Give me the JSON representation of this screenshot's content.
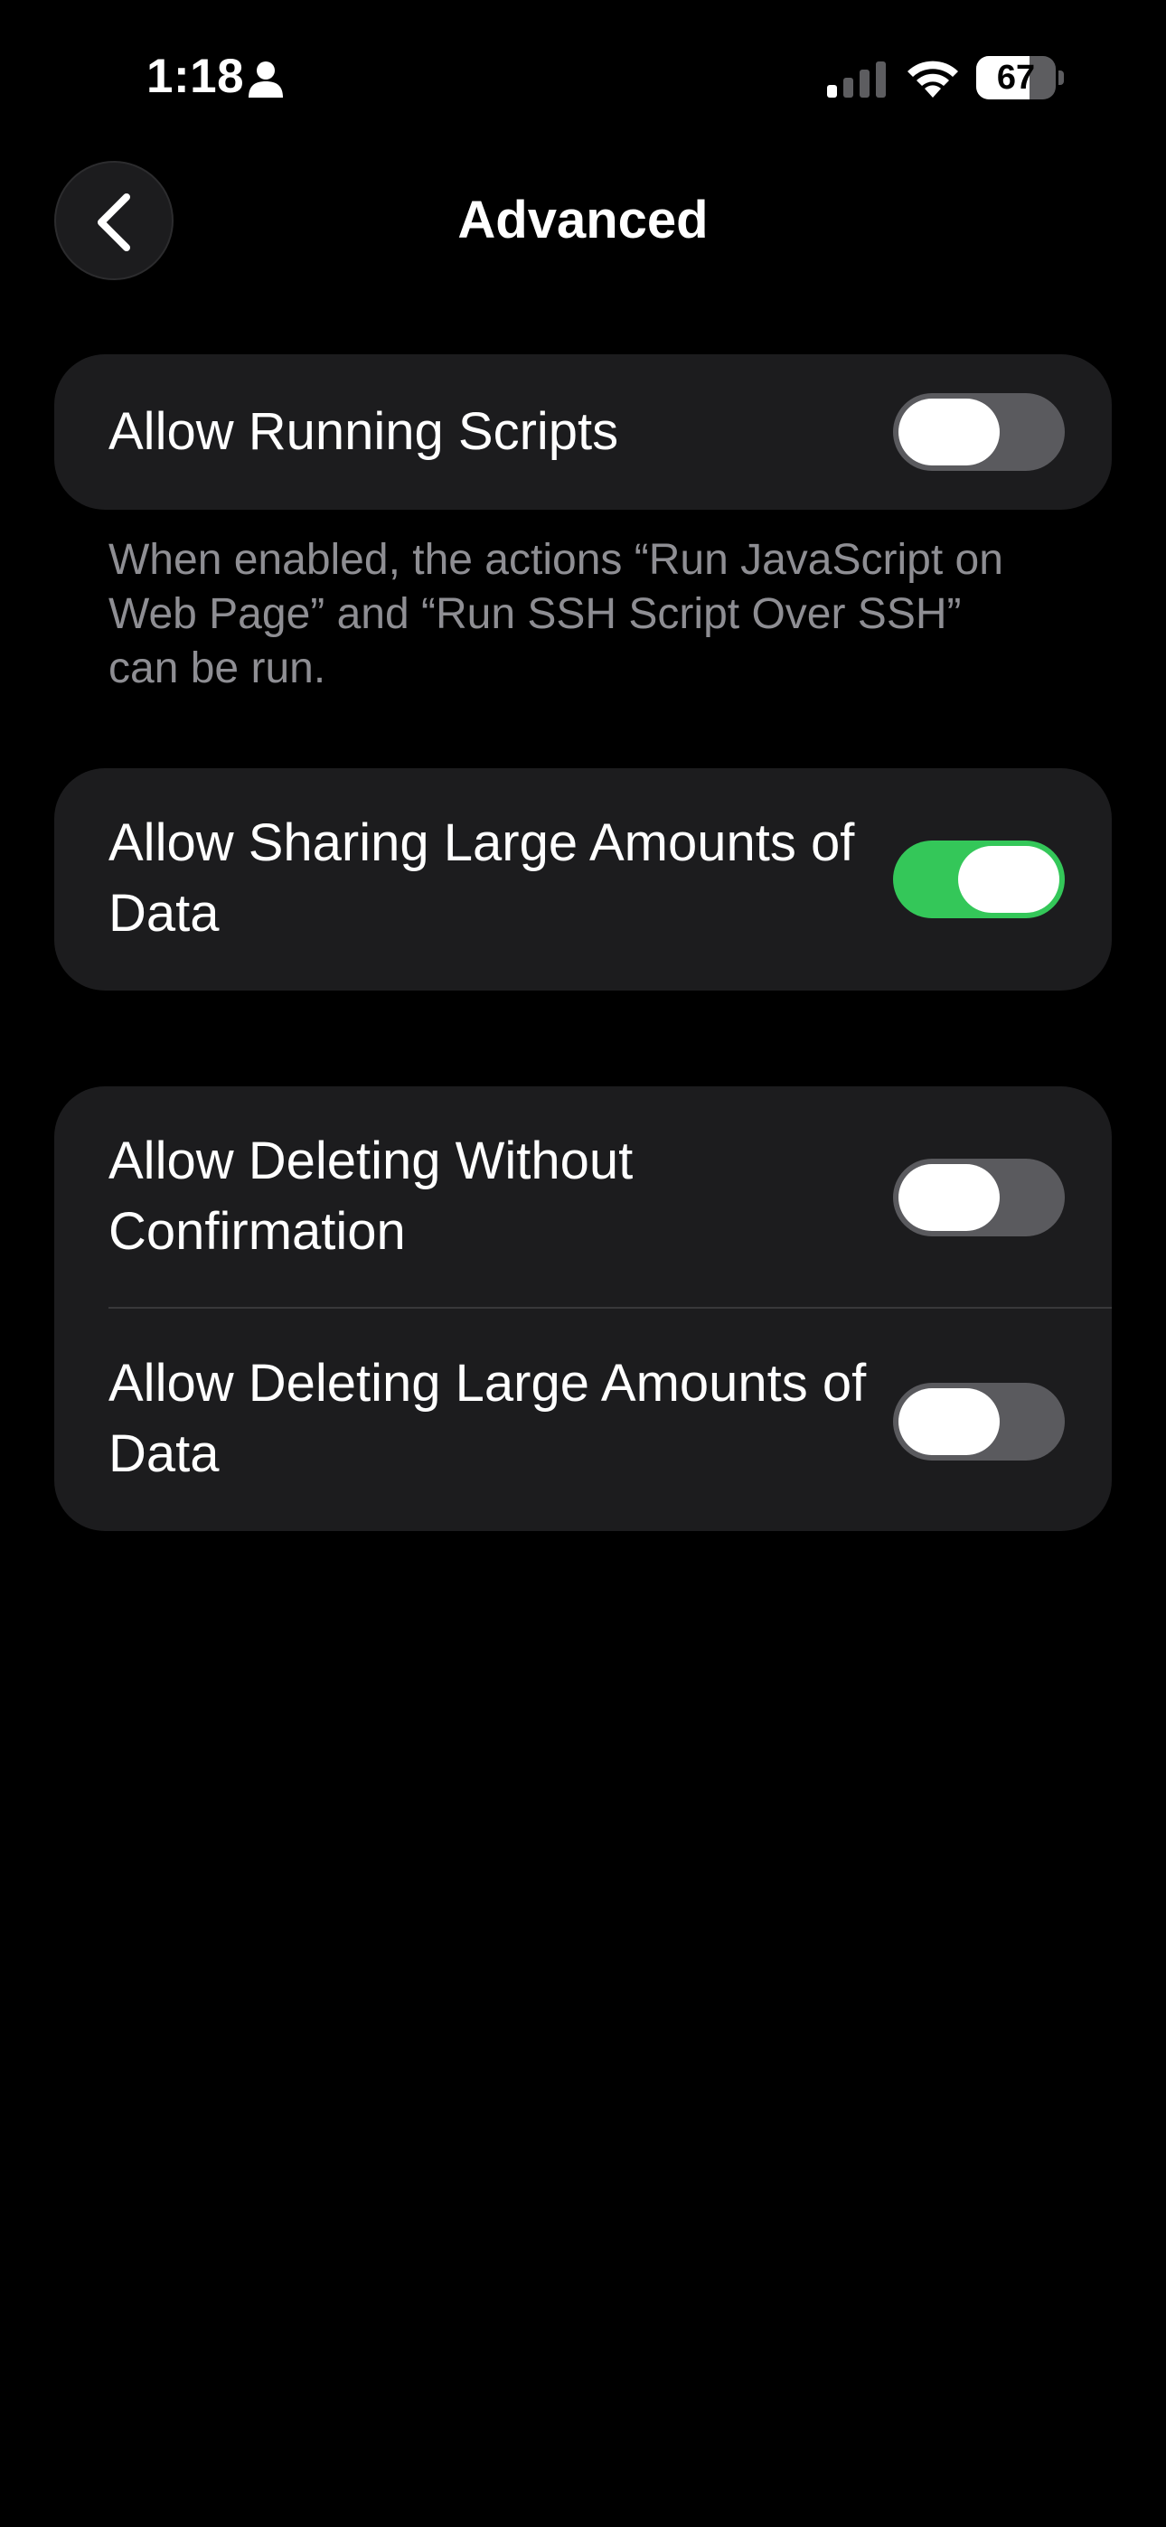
{
  "status_bar": {
    "time": "1:18",
    "battery_percent": "67",
    "battery_level": 0.67,
    "cell_signal_bars_active": 1,
    "cell_signal_bars_total": 4,
    "icons": [
      "person-icon",
      "cellular-signal-icon",
      "wifi-icon",
      "battery-icon"
    ]
  },
  "nav": {
    "title": "Advanced",
    "back_icon": "chevron-left-icon"
  },
  "sections": [
    {
      "rows": [
        {
          "label": "Allow Running Scripts",
          "toggle_on": false
        }
      ],
      "footer": "When enabled, the actions “Run JavaScript on Web Page” and “Run SSH Script Over SSH” can be run."
    },
    {
      "rows": [
        {
          "label": "Allow Sharing Large Amounts of Data",
          "toggle_on": true
        }
      ]
    },
    {
      "rows": [
        {
          "label": "Allow Deleting Without Confirmation",
          "toggle_on": false
        },
        {
          "label": "Allow Deleting Large Amounts of Data",
          "toggle_on": false
        }
      ]
    }
  ],
  "colors": {
    "background": "#000000",
    "card": "#1c1c1e",
    "toggle_on": "#34c759",
    "toggle_off": "#5a5a5e",
    "secondary_text": "#8e8e93"
  }
}
